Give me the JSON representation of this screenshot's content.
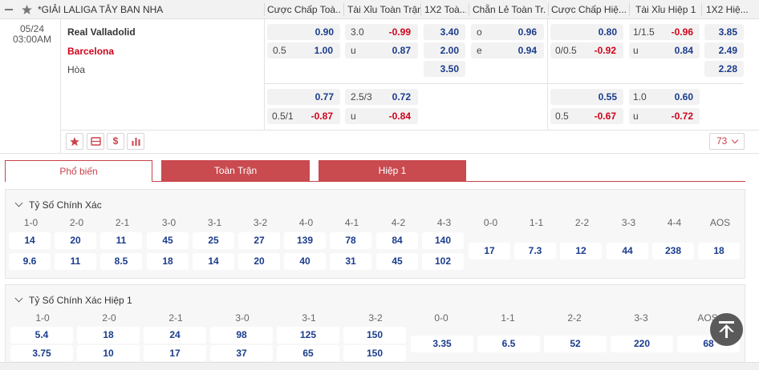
{
  "league": {
    "name": "*GIẢI LALIGA TÂY BAN NHA"
  },
  "columns": [
    "Cược Chấp Toà...",
    "Tài Xỉu Toàn Trận",
    "1X2 Toà...",
    "Chẵn Lẻ Toàn Tr...",
    "Cược Chấp Hiệ...",
    "Tài Xỉu Hiệp 1",
    "1X2 Hiệ..."
  ],
  "match": {
    "date": "05/24",
    "time": "03:00AM",
    "home": "Real Valladolid",
    "away": "Barcelona",
    "draw": "Hòa",
    "more_count": "73"
  },
  "odds": {
    "row1": {
      "hdp_home": "0.90",
      "ou_line": "3.0",
      "ou_over": "-0.99",
      "x12_home": "3.40",
      "oe_odd_lbl": "o",
      "oe_odd": "0.96",
      "h1_hdp_home": "0.80",
      "h1_ou_line": "1/1.5",
      "h1_ou_over": "-0.96",
      "h1_x12_home": "3.85"
    },
    "row2": {
      "hdp_line": "0.5",
      "hdp_away": "1.00",
      "ou_under_lbl": "u",
      "ou_under": "0.87",
      "x12_away": "2.00",
      "oe_even_lbl": "e",
      "oe_even": "0.94",
      "h1_hdp_line": "0/0.5",
      "h1_hdp_away": "-0.92",
      "h1_ou_under_lbl": "u",
      "h1_ou_under": "0.84",
      "h1_x12_away": "2.49"
    },
    "row3": {
      "x12_draw": "3.50",
      "h1_x12_draw": "2.28"
    },
    "row4": {
      "hdp_home": "0.77",
      "ou_line": "2.5/3",
      "ou_over": "0.72",
      "h1_hdp_home": "0.55",
      "h1_ou_line": "1.0",
      "h1_ou_over": "0.60"
    },
    "row5": {
      "hdp_line": "0.5/1",
      "hdp_away": "-0.87",
      "ou_under_lbl": "u",
      "ou_under": "-0.84",
      "h1_hdp_line": "0.5",
      "h1_hdp_away": "-0.67",
      "h1_ou_under_lbl": "u",
      "h1_ou_under": "-0.72"
    }
  },
  "tabs": [
    "Phổ biến",
    "Toàn Trận",
    "Hiệp 1"
  ],
  "correct_score": {
    "title": "Tỷ Số Chính Xác",
    "home_wins": [
      {
        "score": "1-0",
        "home": "14",
        "away": "9.6"
      },
      {
        "score": "2-0",
        "home": "20",
        "away": "11"
      },
      {
        "score": "2-1",
        "home": "11",
        "away": "8.5"
      },
      {
        "score": "3-0",
        "home": "45",
        "away": "18"
      },
      {
        "score": "3-1",
        "home": "25",
        "away": "14"
      },
      {
        "score": "3-2",
        "home": "27",
        "away": "20"
      },
      {
        "score": "4-0",
        "home": "139",
        "away": "40"
      },
      {
        "score": "4-1",
        "home": "78",
        "away": "31"
      },
      {
        "score": "4-2",
        "home": "84",
        "away": "45"
      },
      {
        "score": "4-3",
        "home": "140",
        "away": "102"
      }
    ],
    "draws": [
      {
        "score": "0-0",
        "value": "17"
      },
      {
        "score": "1-1",
        "value": "7.3"
      },
      {
        "score": "2-2",
        "value": "12"
      },
      {
        "score": "3-3",
        "value": "44"
      },
      {
        "score": "4-4",
        "value": "238"
      },
      {
        "score": "AOS",
        "value": "18"
      }
    ]
  },
  "correct_score_h1": {
    "title": "Tỷ Số Chính Xác Hiệp 1",
    "home_wins": [
      {
        "score": "1-0",
        "home": "5.4",
        "away": "3.75"
      },
      {
        "score": "2-0",
        "home": "18",
        "away": "10"
      },
      {
        "score": "2-1",
        "home": "24",
        "away": "17"
      },
      {
        "score": "3-0",
        "home": "98",
        "away": "37"
      },
      {
        "score": "3-1",
        "home": "125",
        "away": "65"
      },
      {
        "score": "3-2",
        "home": "150",
        "away": "150"
      }
    ],
    "draws": [
      {
        "score": "0-0",
        "value": "3.35"
      },
      {
        "score": "1-1",
        "value": "6.5"
      },
      {
        "score": "2-2",
        "value": "52"
      },
      {
        "score": "3-3",
        "value": "220"
      },
      {
        "score": "AOS",
        "value": "68"
      }
    ]
  },
  "colors": {
    "accent": "#c94a4f",
    "odds_blue": "#1a3c8c",
    "odds_red": "#d0021b",
    "cell_bg": "#f2f2f2"
  },
  "icons": [
    "star-icon",
    "minus-icon",
    "scoreboard-icon",
    "dollar-icon",
    "stats-icon",
    "arrow-up-icon"
  ]
}
